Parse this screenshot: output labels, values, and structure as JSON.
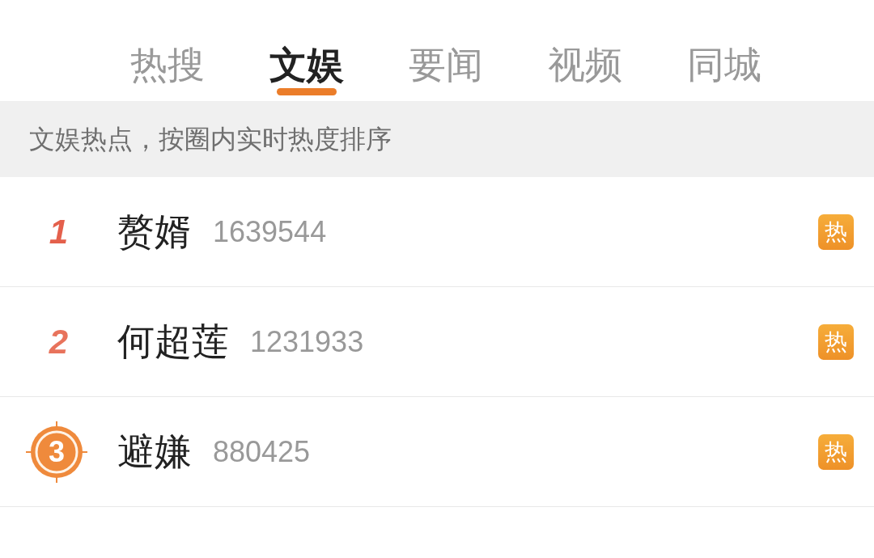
{
  "tabs": [
    {
      "label": "热搜",
      "selected": false
    },
    {
      "label": "文娱",
      "selected": true
    },
    {
      "label": "要闻",
      "selected": false
    },
    {
      "label": "视频",
      "selected": false
    },
    {
      "label": "同城",
      "selected": false
    }
  ],
  "notice": "文娱热点，按圈内实时热度排序",
  "rows": [
    {
      "rank": "1",
      "kind": "number",
      "color": "#e4604c",
      "title": "赘婿",
      "count": "1639544",
      "badge": {
        "text": "热",
        "kind": "hot"
      }
    },
    {
      "rank": "2",
      "kind": "number",
      "color": "#e8735c",
      "title": "何超莲",
      "count": "1231933",
      "badge": {
        "text": "热",
        "kind": "hot"
      }
    },
    {
      "rank": "3",
      "kind": "medal",
      "color": "#ef8a3c",
      "title": "避嫌",
      "count": "880425",
      "badge": {
        "text": "热",
        "kind": "hot"
      }
    }
  ]
}
